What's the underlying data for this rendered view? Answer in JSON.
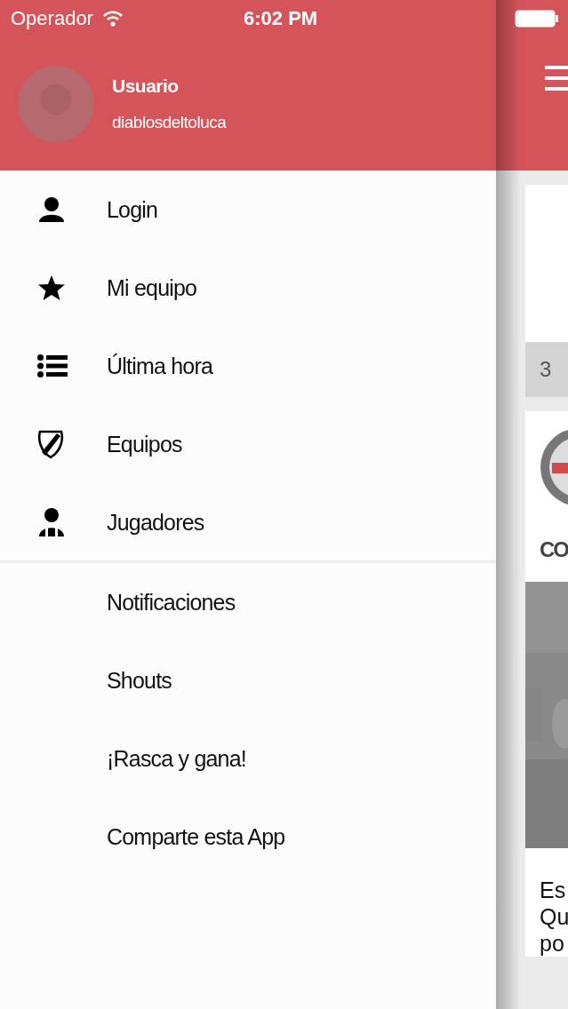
{
  "status_bar": {
    "carrier": "Operador",
    "time": "6:02 PM"
  },
  "profile": {
    "name": "Usuario",
    "username": "diablosdeltoluca"
  },
  "menu": [
    {
      "label": "Login"
    },
    {
      "label": "Mi equipo"
    },
    {
      "label": "Última hora"
    },
    {
      "label": "Equipos"
    },
    {
      "label": "Jugadores"
    }
  ],
  "secondary_menu": [
    {
      "label": "Notificaciones"
    },
    {
      "label": "Shouts"
    },
    {
      "label": "¡Rasca y gana!"
    },
    {
      "label": "Comparte esta App"
    }
  ],
  "background_feed": {
    "date_bar": "3",
    "post": {
      "title": "CO",
      "lines": [
        "Es",
        "Qu",
        "po"
      ]
    }
  }
}
